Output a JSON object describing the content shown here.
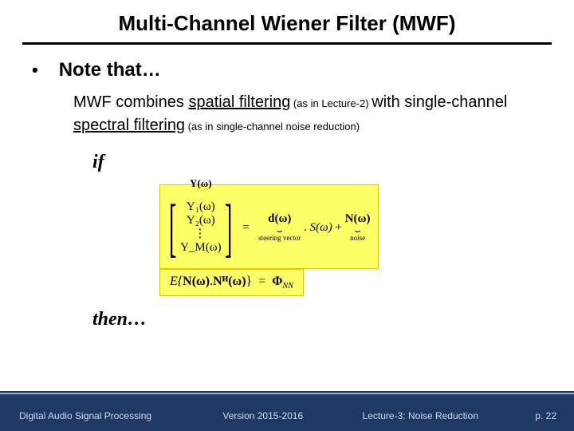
{
  "title": "Multi-Channel Wiener Filter (MWF)",
  "bullet": {
    "mark": "•",
    "heading": "Note that…"
  },
  "para": {
    "t1": "MWF combines ",
    "u1": "spatial filtering",
    "s1": " (as in Lecture-2) ",
    "t2": "with single-channel ",
    "u2": "spectral filtering",
    "s2": " (as in single-channel noise reduction)"
  },
  "kw_if": "if",
  "kw_then": "then…",
  "eq_main": {
    "yhead": "Y(ω)",
    "y1": "Y₁(ω)",
    "y2": "Y₂(ω)",
    "dots": "⋮",
    "ym": "Y_M(ω)",
    "eq": "=",
    "d": "d(ω)",
    "d_lbl": "steering vector",
    "dot": ".",
    "s": "S(ω)",
    "plus": "+",
    "n": "N(ω)",
    "n_lbl": "noise"
  },
  "eq_noise": {
    "lhs_open": "E{",
    "n1": "N(ω)",
    "dot": ".",
    "n2": "Nᴴ(ω)",
    "lhs_close": "}",
    "eq": "=",
    "phi": "Φ",
    "sub": "NN"
  },
  "footer": {
    "left": "Digital Audio Signal Processing",
    "center": "Version 2015-2016",
    "right": "Lecture-3: Noise Reduction",
    "page": "p. 22"
  }
}
